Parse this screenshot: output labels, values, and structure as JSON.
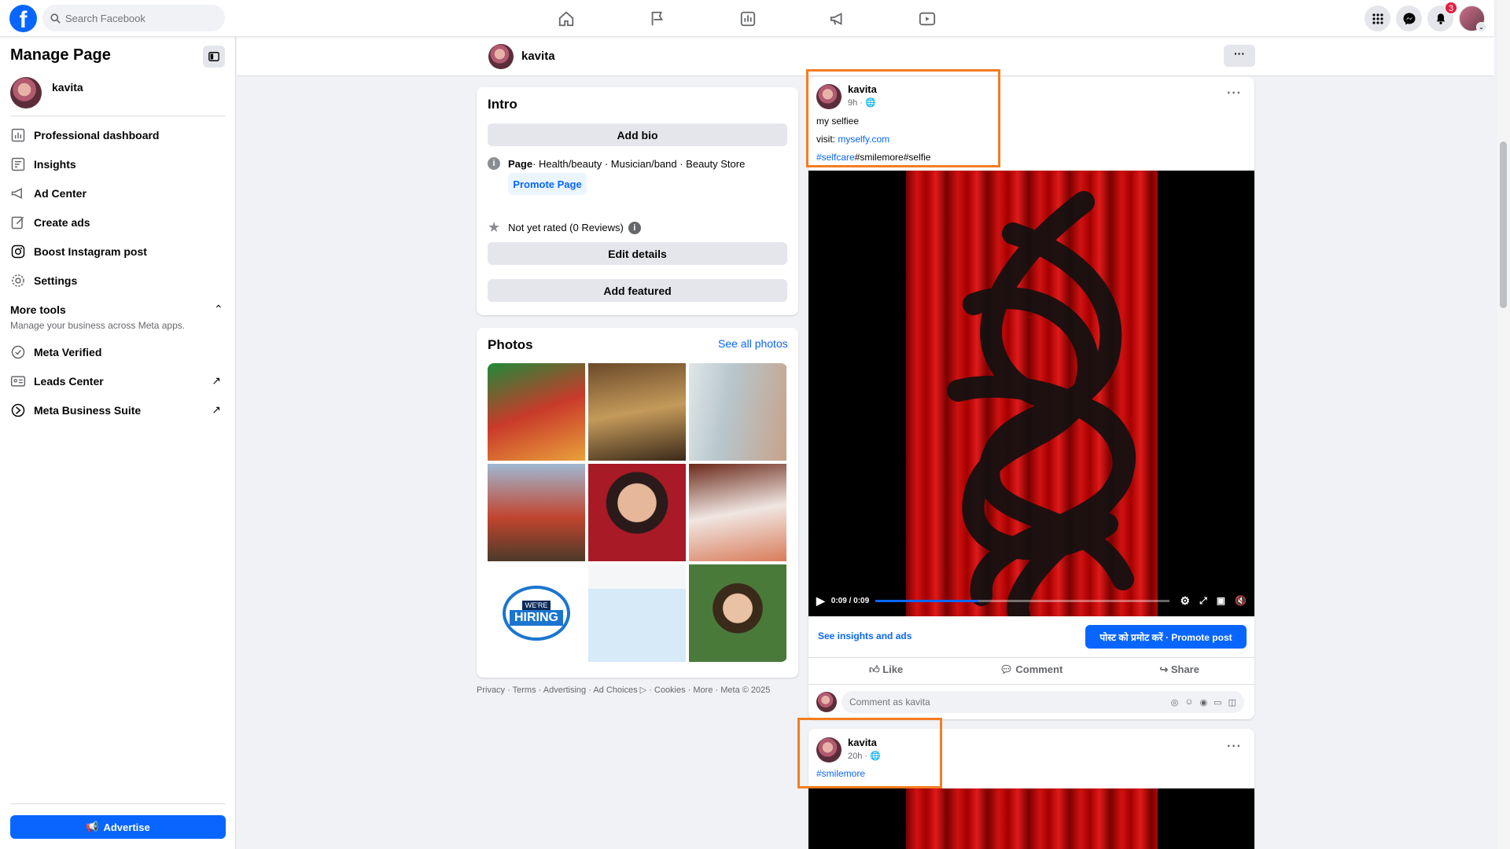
{
  "topbar": {
    "search_placeholder": "Search Facebook",
    "nav_icons": [
      "home-icon",
      "flag-icon",
      "insights-icon",
      "megaphone-icon",
      "video-icon"
    ],
    "right_icons": [
      "menu-grid-icon",
      "messenger-icon",
      "notifications-icon"
    ],
    "notifications_count": "3",
    "accent_color": "#0866ff"
  },
  "sidebar": {
    "title": "Manage Page",
    "profile_name": "kavita",
    "items": [
      {
        "label": "Professional dashboard",
        "icon": "dashboard-icon"
      },
      {
        "label": "Insights",
        "icon": "insights-icon"
      },
      {
        "label": "Ad Center",
        "icon": "megaphone-icon"
      },
      {
        "label": "Create ads",
        "icon": "pencil-icon"
      },
      {
        "label": "Boost Instagram post",
        "icon": "instagram-icon"
      },
      {
        "label": "Settings",
        "icon": "gear-icon"
      }
    ],
    "more_tools": {
      "title": "More tools",
      "subtitle": "Manage your business across Meta apps.",
      "items": [
        {
          "label": "Meta Verified",
          "icon": "verified-icon"
        },
        {
          "label": "Leads Center",
          "icon": "leads-icon"
        },
        {
          "label": "Meta Business Suite",
          "icon": "business-suite-icon"
        }
      ]
    },
    "advertise_label": "Advertise"
  },
  "page_header": {
    "name": "kavita",
    "more_label": "···"
  },
  "intro": {
    "title": "Intro",
    "add_bio": "Add bio",
    "page_label": "Page",
    "categories": " · Health/beauty · Musician/band · Beauty Store",
    "promote_page": "Promote Page",
    "rating": "Not yet rated (0 Reviews)",
    "edit_details": "Edit details",
    "add_featured": "Add featured"
  },
  "photos": {
    "title": "Photos",
    "see_all": "See all photos",
    "hiring_top": "WE'RE",
    "hiring_main": "HIRING"
  },
  "footer": {
    "links": "Privacy · Terms · Advertising · Ad Choices ▷ · Cookies · More · Meta © 2025"
  },
  "post1": {
    "author": "kavita",
    "time": "9h · ",
    "line1": "my selfiee",
    "visit_label": "visit: ",
    "visit_link": "myselfy.com",
    "hashtag_link": "#selfcare",
    "hashtags_rest": "#smilemore#selfie",
    "video_time": "0:09 / 0:09",
    "video_progress": 0.35,
    "insights_link": "See insights and ads",
    "promote_post": "पोस्ट को प्रमोट करें · Promote post",
    "like": "Like",
    "comment": "Comment",
    "share": "Share",
    "comment_placeholder": "Comment as kavita"
  },
  "post2": {
    "author": "kavita",
    "time": "20h · ",
    "hashtag": "#smilemore"
  }
}
